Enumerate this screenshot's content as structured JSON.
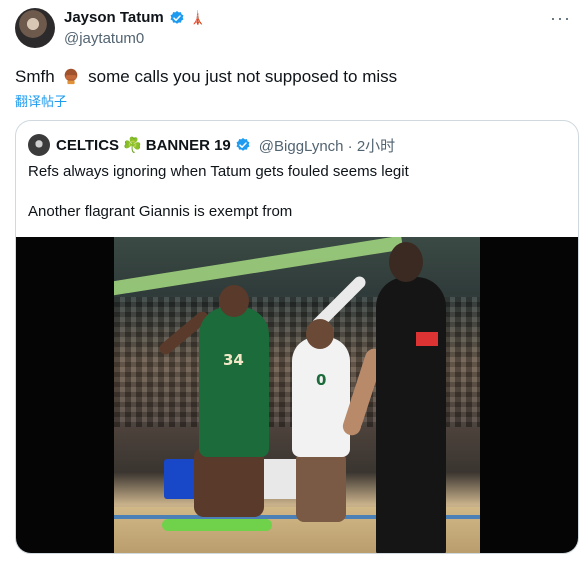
{
  "author": {
    "name": "Jayson Tatum",
    "handle": "@jaytatum0",
    "badge_emoji": "🗼"
  },
  "tweet": {
    "text_prefix": "Smfh",
    "text_suffix": " some calls you just not supposed to miss",
    "translate_label": "翻译帖子"
  },
  "menu_label": "···",
  "quote": {
    "name_part1": "CELTICS",
    "shamrock": "☘️",
    "name_part2": "BANNER 19",
    "handle_time": "@BiggLynch · 2小时",
    "line1": "Refs always ignoring when Tatum gets fouled seems legit",
    "line2": "Another flagrant Giannis is exempt from"
  },
  "video": {
    "green_number": "34",
    "white_number": "0"
  },
  "colors": {
    "accent": "#1d9bf0",
    "muted": "#536471",
    "border": "#cfd9de"
  }
}
